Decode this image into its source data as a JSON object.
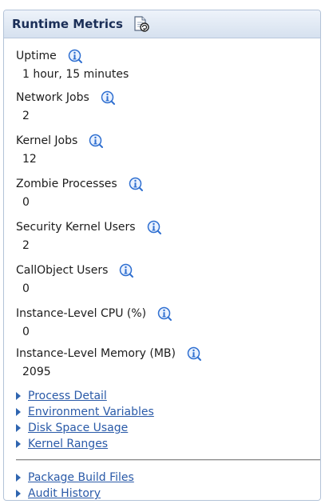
{
  "panel": {
    "title": "Runtime Metrics",
    "refresh_icon": "refresh-page-icon"
  },
  "metrics": [
    {
      "label": "Uptime",
      "value": "1 hour, 15 minutes",
      "icon": "info-icon"
    },
    {
      "label": "Network Jobs",
      "value": "2",
      "icon": "info-icon"
    },
    {
      "label": "Kernel Jobs",
      "value": "12",
      "icon": "info-icon"
    },
    {
      "label": "Zombie Processes",
      "value": "0",
      "icon": "info-icon"
    },
    {
      "label": "Security Kernel Users",
      "value": "2",
      "icon": "info-icon"
    },
    {
      "label": "CallObject Users",
      "value": "0",
      "icon": "info-icon"
    },
    {
      "label": "Instance-Level CPU (%)",
      "value": "0",
      "icon": "info-icon"
    },
    {
      "label": "Instance-Level Memory (MB)",
      "value": "2095",
      "icon": "info-icon"
    }
  ],
  "links_primary": [
    "Process Detail",
    "Environment Variables",
    "Disk Space Usage",
    "Kernel Ranges"
  ],
  "links_secondary": [
    "Package Build Files",
    "Audit History"
  ],
  "colors": {
    "header_text": "#1a2e57",
    "link": "#2a5aa8",
    "info_icon": "#2f6fd0"
  }
}
